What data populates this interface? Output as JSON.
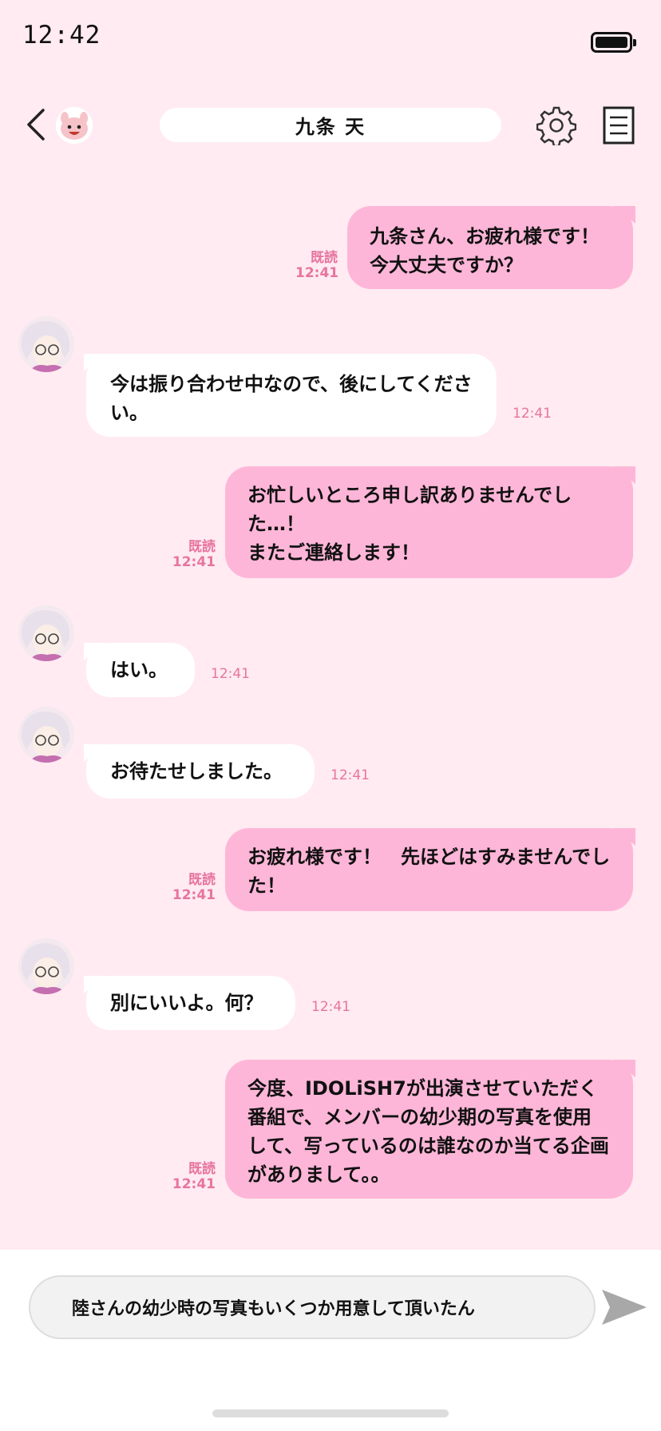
{
  "status_bar": {
    "time": "12:42"
  },
  "header": {
    "contact_name": "九条 天"
  },
  "messages": [
    {
      "text": "九条さん、お疲れ様です！\n今大丈夫ですか？",
      "read": "既読",
      "time": "12:41"
    },
    {
      "text": "今は振り合わせ中なので、後にしてください。",
      "time": "12:41"
    },
    {
      "text": "お忙しいところ申し訳ありませんでした…！\nまたご連絡します！",
      "read": "既読",
      "time": "12:41"
    },
    {
      "text": "はい。",
      "time": "12:41"
    },
    {
      "text": "お待たせしました。",
      "time": "12:41"
    },
    {
      "text": "お疲れ様です！　先ほどはすみませんでした！",
      "read": "既読",
      "time": "12:41"
    },
    {
      "text": "別にいいよ。何？",
      "time": "12:41"
    },
    {
      "text": "今度、IDOLiSH7が出演させていただく番組で、メンバーの幼少期の写真を使用して、写っているのは誰なのか当てる企画がありまして。。",
      "read": "既読",
      "time": "12:41"
    }
  ],
  "composer": {
    "text": "陸さんの幼少時の写真もいくつか用意して頂いたん"
  },
  "colors": {
    "background": "#ffebf1",
    "outgoing_bubble": "#feb6d8",
    "incoming_bubble": "#ffffff",
    "accent_text": "#e7749f"
  },
  "icons": {
    "back": "chevron-left-icon",
    "settings": "gear-icon",
    "menu": "document-menu-icon",
    "send": "send-arrow-icon"
  }
}
